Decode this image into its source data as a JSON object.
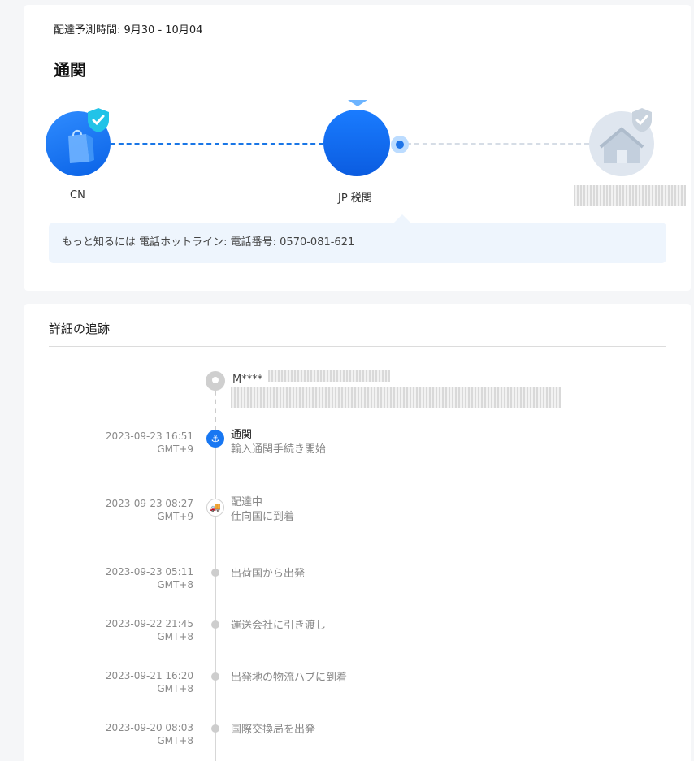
{
  "summary": {
    "eta": "配達予測時間: 9月30 - 10月04",
    "status_title": "通関"
  },
  "progress": {
    "nodes": [
      {
        "label": "CN",
        "icon": "shopping-bag-icon"
      },
      {
        "label": "JP 税関",
        "icon": "customs-icon"
      },
      {
        "label": "",
        "icon": "house-icon"
      }
    ]
  },
  "hotline": {
    "text": "もっと知るには 電話ホットライン: 電話番号: 0570-081-621"
  },
  "detail": {
    "title": "詳細の追跡",
    "address_name": "M****"
  },
  "events": [
    {
      "time": "2023-09-23 16:51",
      "tz": "GMT+9",
      "status": "通関",
      "desc": "輸入通関手続き開始",
      "icon": "customs-anchor-icon"
    },
    {
      "time": "2023-09-23 08:27",
      "tz": "GMT+9",
      "status": "配達中",
      "desc": "仕向国に到着",
      "icon": "truck-icon"
    },
    {
      "time": "2023-09-23 05:11",
      "tz": "GMT+8",
      "status": "",
      "desc": "出荷国から出発",
      "icon": "dot-icon"
    },
    {
      "time": "2023-09-22 21:45",
      "tz": "GMT+8",
      "status": "",
      "desc": "運送会社に引き渡し",
      "icon": "dot-icon"
    },
    {
      "time": "2023-09-21 16:20",
      "tz": "GMT+8",
      "status": "",
      "desc": "出発地の物流ハブに到着",
      "icon": "dot-icon"
    },
    {
      "time": "2023-09-20 08:03",
      "tz": "GMT+8",
      "status": "",
      "desc": "国際交換局を出発",
      "icon": "dot-icon"
    }
  ],
  "colors": {
    "accent": "#1877f2",
    "hotline_bg": "#eef5fd",
    "inactive": "#dfe6ef"
  }
}
